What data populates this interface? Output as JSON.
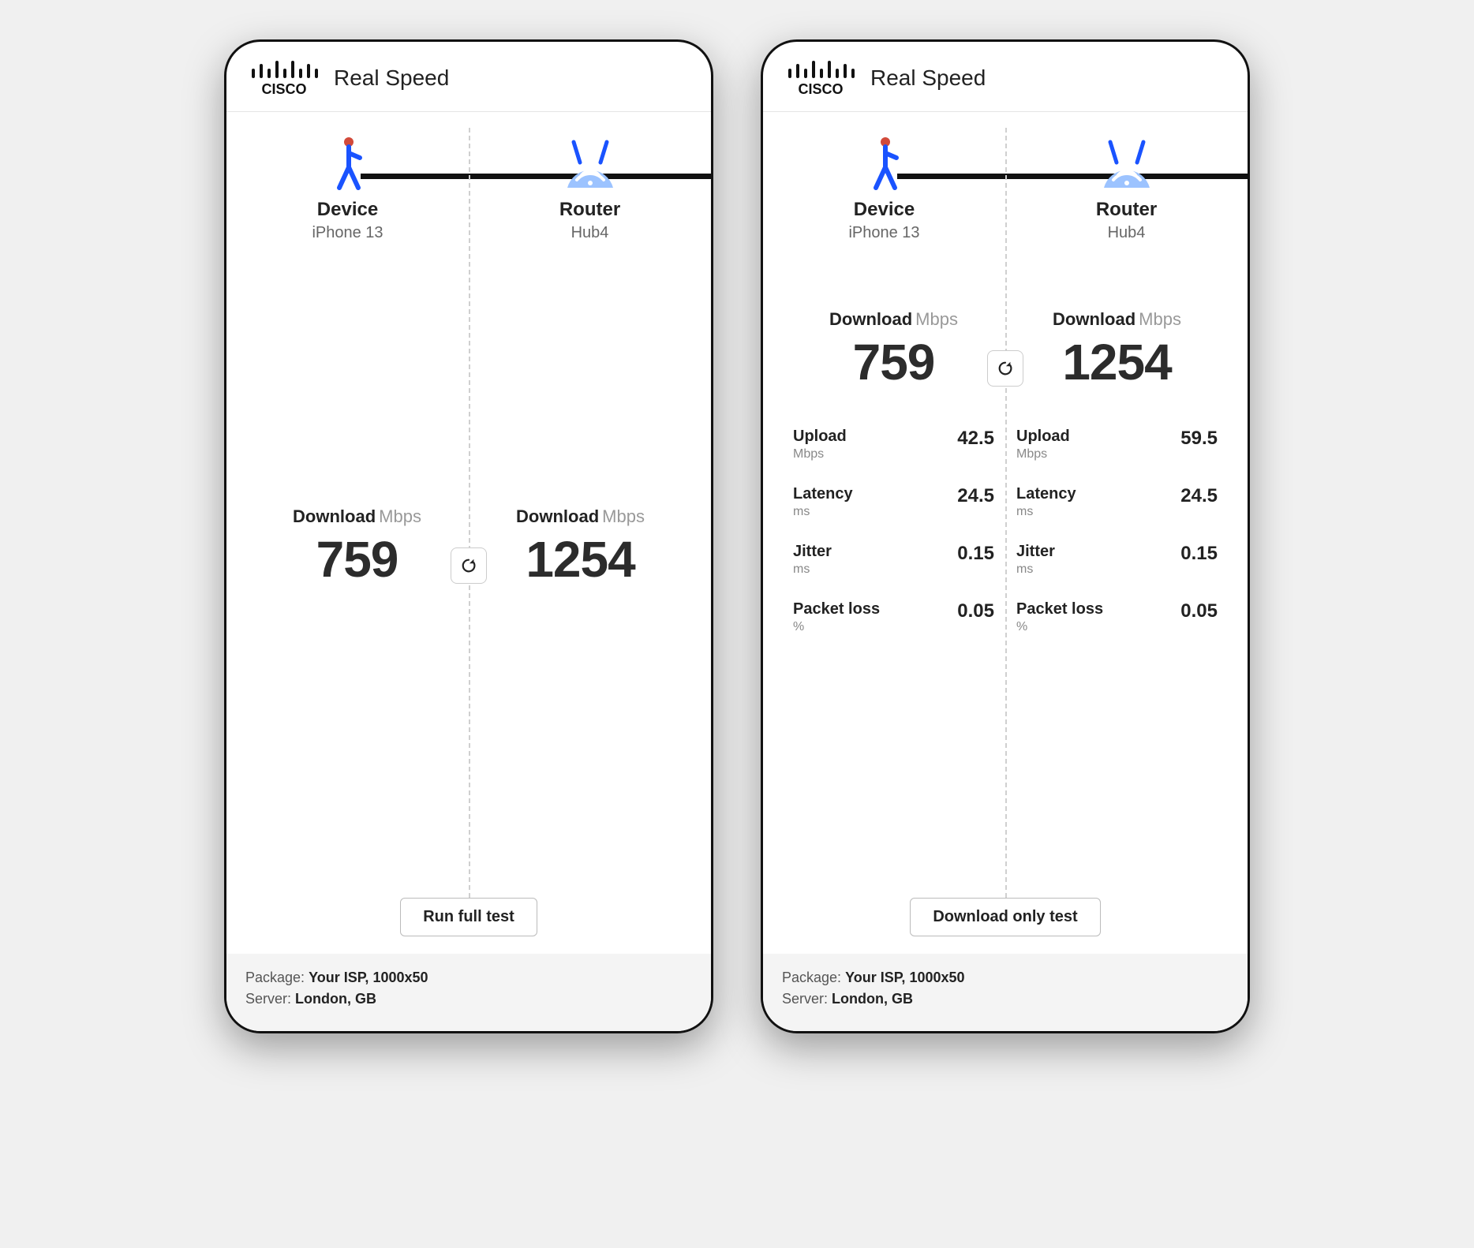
{
  "app_title": "Real Speed",
  "device": {
    "label": "Device",
    "name": "iPhone 13"
  },
  "router": {
    "label": "Router",
    "name": "Hub4"
  },
  "download_label": "Download",
  "mbps_unit": "Mbps",
  "ms_unit": "ms",
  "pct_unit": "%",
  "left_panel": {
    "device_download": "759",
    "router_download": "1254",
    "button": "Run full test"
  },
  "right_panel": {
    "device_download": "759",
    "router_download": "1254",
    "button": "Download only test",
    "metrics": {
      "upload_label": "Upload",
      "latency_label": "Latency",
      "jitter_label": "Jitter",
      "packetloss_label": "Packet loss",
      "device": {
        "upload": "42.5",
        "latency": "24.5",
        "jitter": "0.15",
        "packetloss": "0.05"
      },
      "router": {
        "upload": "59.5",
        "latency": "24.5",
        "jitter": "0.15",
        "packetloss": "0.05"
      }
    }
  },
  "footer": {
    "package_label": "Package:",
    "package_value": "Your ISP, 1000x50",
    "server_label": "Server:",
    "server_value": "London, GB"
  }
}
